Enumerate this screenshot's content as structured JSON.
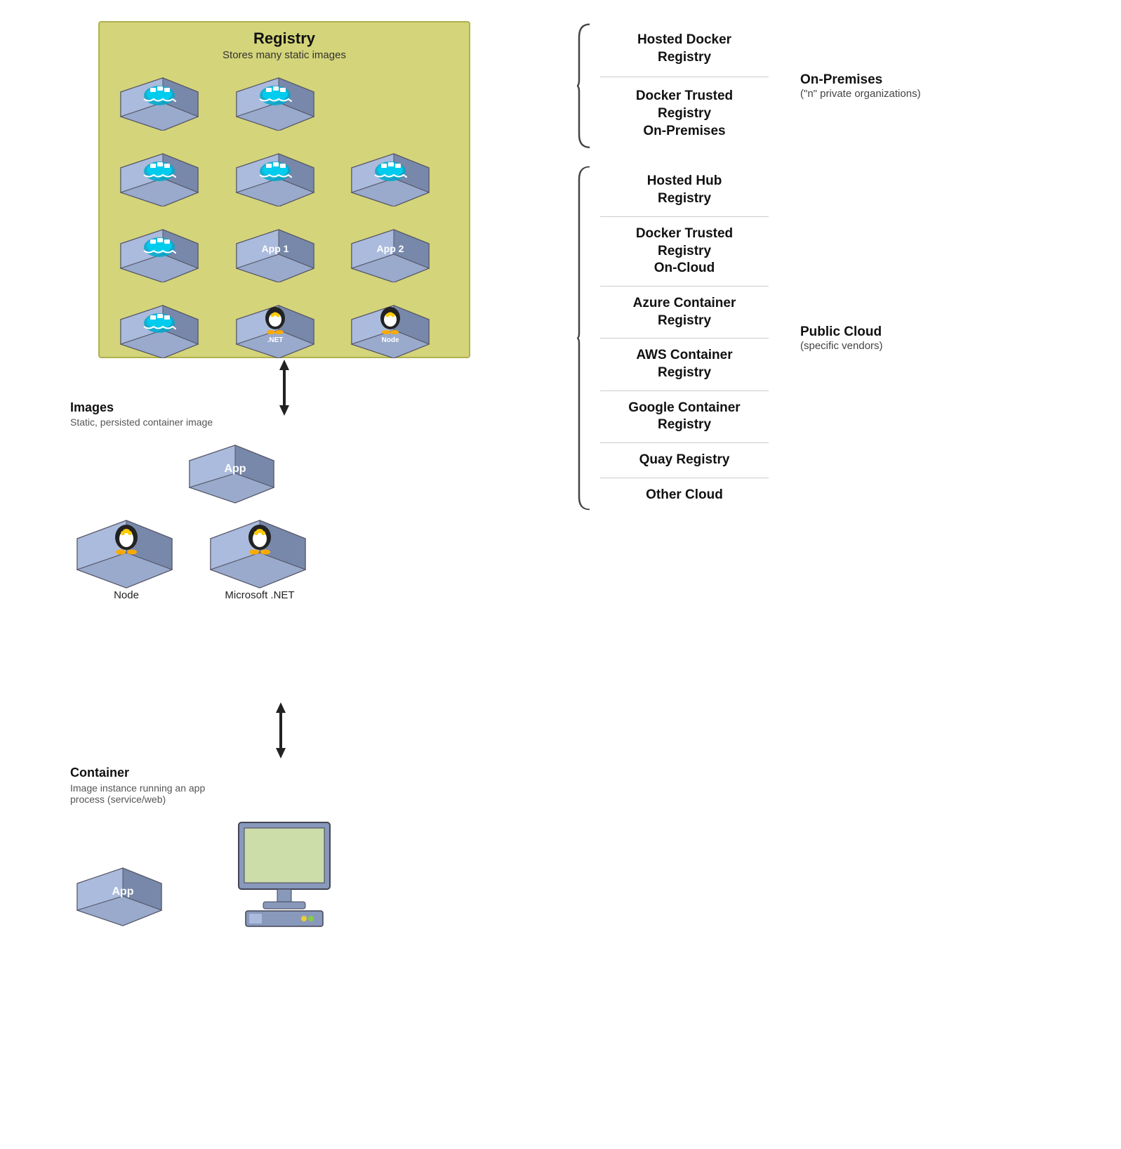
{
  "registry": {
    "title": "Registry",
    "subtitle": "Stores many static images",
    "containers": [
      {
        "type": "docker",
        "label": ""
      },
      {
        "type": "docker",
        "label": ""
      },
      {
        "type": "empty",
        "label": ""
      },
      {
        "type": "docker",
        "label": ""
      },
      {
        "type": "docker",
        "label": ""
      },
      {
        "type": "docker",
        "label": ""
      },
      {
        "type": "docker",
        "label": ""
      },
      {
        "type": "app1",
        "label": "App 1"
      },
      {
        "type": "app2",
        "label": "App 2"
      },
      {
        "type": "docker",
        "label": ""
      },
      {
        "type": "net",
        "label": ".NET"
      },
      {
        "type": "node",
        "label": "Node"
      }
    ]
  },
  "images": {
    "title": "Images",
    "subtitle": "Static, persisted container image",
    "containers": [
      {
        "type": "app",
        "label": "App"
      },
      {
        "type": "node",
        "label": "Node"
      },
      {
        "type": "net",
        "label": "Microsoft .NET"
      }
    ]
  },
  "container_section": {
    "title": "Container",
    "subtitle": "Image instance  running an app process (service/web)",
    "label": "App"
  },
  "right_panel": {
    "on_premises": {
      "label": "On-Premises",
      "sublabel": "(\"n\" private organizations)",
      "items": [
        "Hosted Docker\nRegistry",
        "Docker Trusted\nRegistry\nOn-Premises"
      ]
    },
    "public_cloud": {
      "label": "Public Cloud",
      "sublabel": "(specific vendors)",
      "items": [
        "Hosted Hub\nRegistry",
        "Docker Trusted\nRegistry\nOn-Cloud",
        "Azure Container\nRegistry",
        "AWS Container\nRegistry",
        "Google Container\nRegistry",
        "Quay Registry",
        "Other Cloud"
      ]
    }
  }
}
